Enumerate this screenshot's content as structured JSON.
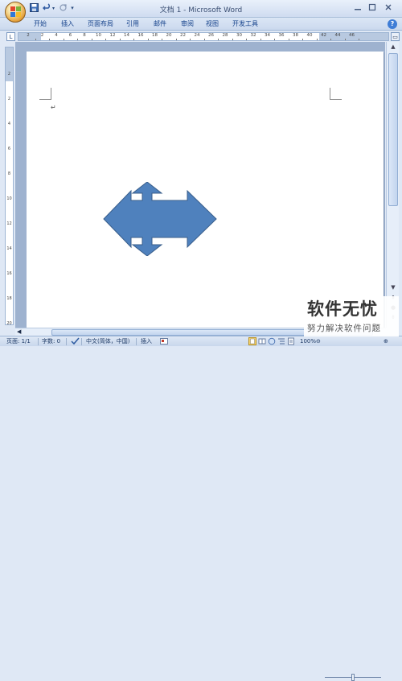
{
  "window": {
    "title": "文档 1 - Microsoft Word"
  },
  "qat": {
    "save_icon": "save-icon",
    "undo_icon": "undo-icon",
    "redo_icon": "redo-icon",
    "customize_icon": "customize-qat-icon"
  },
  "ribbon": {
    "tabs": [
      {
        "label": "开始"
      },
      {
        "label": "插入"
      },
      {
        "label": "页面布局"
      },
      {
        "label": "引用"
      },
      {
        "label": "邮件"
      },
      {
        "label": "审阅"
      },
      {
        "label": "视图"
      },
      {
        "label": "开发工具"
      }
    ]
  },
  "ruler": {
    "h_labels": [
      "2",
      "2",
      "4",
      "6",
      "8",
      "10",
      "12",
      "14",
      "16",
      "18",
      "20",
      "22",
      "24",
      "26",
      "28",
      "30",
      "32",
      "34",
      "36",
      "38",
      "40",
      "42",
      "44",
      "46"
    ],
    "v_labels": [
      "2",
      "2",
      "4",
      "6",
      "8",
      "10",
      "12",
      "14",
      "16",
      "18",
      "20"
    ]
  },
  "document": {
    "paragraph_mark": "↵",
    "shape": "four-way-arrow",
    "shape_fill": "#4f81bd",
    "shape_stroke": "#385d8a"
  },
  "statusbar": {
    "page": "页面: 1/1",
    "words": "字数: 0",
    "language": "中文(简体，中国)",
    "mode": "插入",
    "zoom": "100%",
    "zoom_minus": "⊖",
    "zoom_plus": "⊕"
  },
  "watermark": {
    "title": "软件无忧",
    "subtitle": "努力解决软件问题"
  }
}
